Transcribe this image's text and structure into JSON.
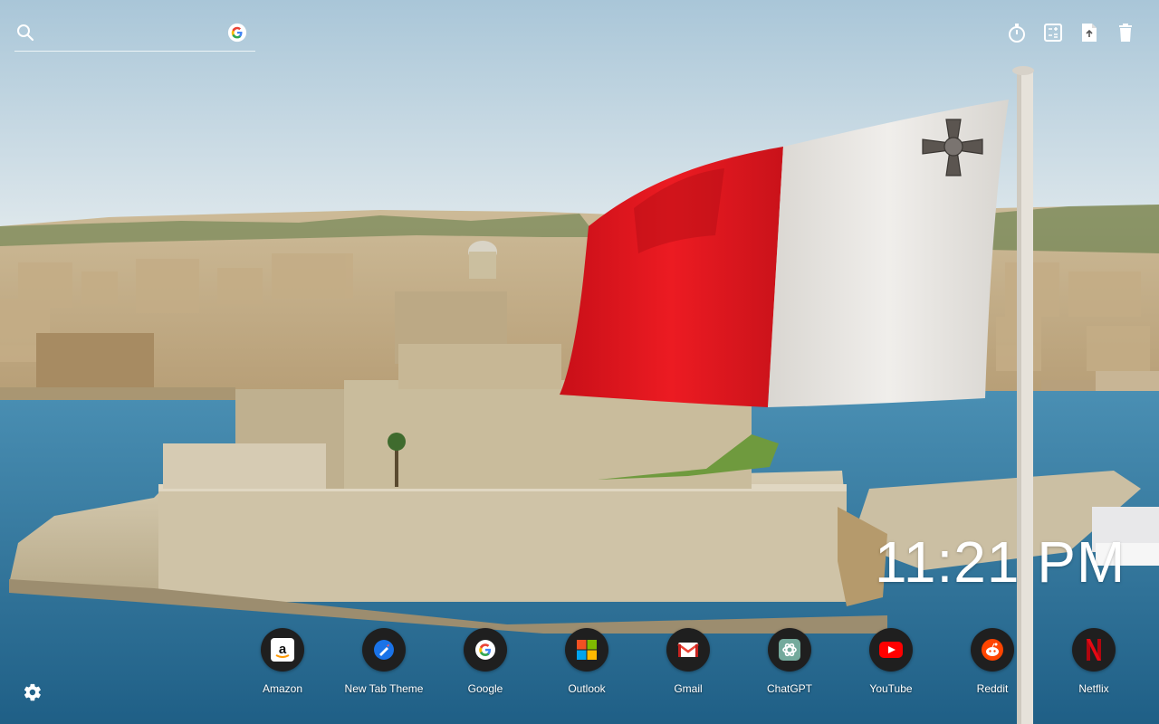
{
  "search": {
    "placeholder": "",
    "engine_icon": "google-icon"
  },
  "toolbar": [
    {
      "name": "timer-icon"
    },
    {
      "name": "calculator-icon"
    },
    {
      "name": "notes-icon"
    },
    {
      "name": "trash-icon"
    }
  ],
  "clock": {
    "time": "11:21 PM"
  },
  "apps": [
    {
      "label": "Amazon",
      "icon": "amazon-icon"
    },
    {
      "label": "New Tab Theme",
      "icon": "new-tab-theme-icon"
    },
    {
      "label": "Google",
      "icon": "google-icon"
    },
    {
      "label": "Outlook",
      "icon": "outlook-icon"
    },
    {
      "label": "Gmail",
      "icon": "gmail-icon"
    },
    {
      "label": "ChatGPT",
      "icon": "chatgpt-icon"
    },
    {
      "label": "YouTube",
      "icon": "youtube-icon"
    },
    {
      "label": "Reddit",
      "icon": "reddit-icon"
    },
    {
      "label": "Netflix",
      "icon": "netflix-icon"
    }
  ],
  "settings": {
    "icon": "gear-icon"
  },
  "colors": {
    "flag_red": "#e3141c",
    "flag_white": "#ececec",
    "sea": "#3b7ea6",
    "sky": "#b9d3e3"
  }
}
